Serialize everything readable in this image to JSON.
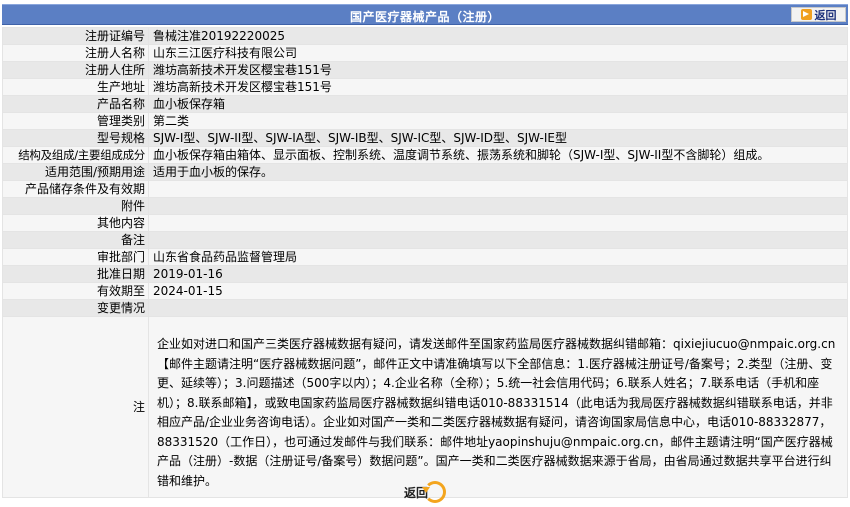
{
  "header": {
    "title": "国产医疗器械产品（注册）",
    "back_label": "返回"
  },
  "rows": [
    {
      "label": "注册证编号",
      "value": "鲁械注准20192220025"
    },
    {
      "label": "注册人名称",
      "value": "山东三江医疗科技有限公司"
    },
    {
      "label": "注册人住所",
      "value": "潍坊高新技术开发区樱宝巷151号"
    },
    {
      "label": "生产地址",
      "value": "潍坊高新技术开发区樱宝巷151号"
    },
    {
      "label": "产品名称",
      "value": "血小板保存箱"
    },
    {
      "label": "管理类别",
      "value": "第二类"
    },
    {
      "label": "型号规格",
      "value": "SJW-I型、SJW-II型、SJW-IA型、SJW-IB型、SJW-IC型、SJW-ID型、SJW-IE型"
    },
    {
      "label": "结构及组成/主要组成成分",
      "value": "血小板保存箱由箱体、显示面板、控制系统、温度调节系统、振荡系统和脚轮（SJW-I型、SJW-II型不含脚轮）组成。"
    },
    {
      "label": "适用范围/预期用途",
      "value": "适用于血小板的保存。"
    },
    {
      "label": "产品储存条件及有效期",
      "value": ""
    },
    {
      "label": "附件",
      "value": ""
    },
    {
      "label": "其他内容",
      "value": ""
    },
    {
      "label": "备注",
      "value": ""
    },
    {
      "label": "审批部门",
      "value": "山东省食品药品监督管理局"
    },
    {
      "label": "批准日期",
      "value": "2019-01-16"
    },
    {
      "label": "有效期至",
      "value": "2024-01-15"
    },
    {
      "label": "变更情况",
      "value": ""
    }
  ],
  "note": {
    "label": "注",
    "text": "企业如对进口和国产三类医疗器械数据有疑问，请发送邮件至国家药监局医疗器械数据纠错邮箱：qixiejiucuo@nmpaic.org.cn【邮件主题请注明“医疗器械数据问题”，邮件正文中请准确填写以下全部信息：1.医疗器械注册证号/备案号；2.类型（注册、变更、延续等）；3.问题描述（500字以内）；4.企业名称（全称）；5.统一社会信用代码；6.联系人姓名；7.联系电话（手机和座机）；8.联系邮箱】，或致电国家药监局医疗器械数据纠错电话010-88331514（此电话为我局医疗器械数据纠错联系电话，并非相应产品/企业业务咨询电话）。企业如对国产一类和二类医疗器械数据有疑问，请咨询国家局信息中心，电话010-88332877，88331520（工作日），也可通过发邮件与我们联系：邮件地址yaopinshuju@nmpaic.org.cn，邮件主题请注明“国产医疗器械产品（注册）-数据（注册证号/备案号）数据问题”。国产一类和二类医疗器械数据来源于省局，由省局通过数据共享平台进行纠错和维护。"
  },
  "footer": {
    "back_label": "返回"
  },
  "colors": {
    "title_bar": "#5b7fc4",
    "row_odd": "#e8e8e8",
    "row_even": "#f6f6f6",
    "back_accent": "#f3a51e"
  }
}
